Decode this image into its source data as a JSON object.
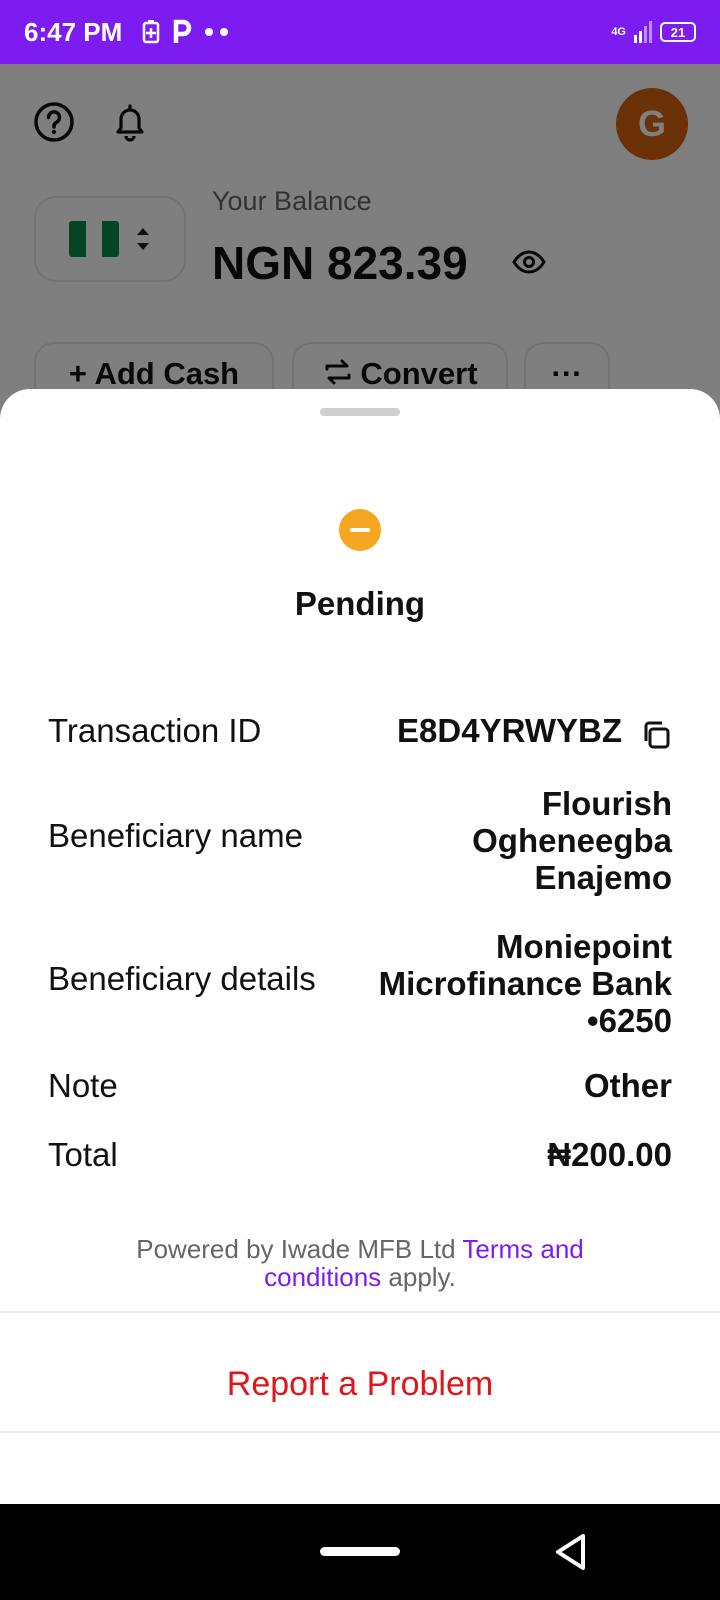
{
  "status_bar": {
    "time": "6:47 PM",
    "network": "4G",
    "battery": "21"
  },
  "background": {
    "avatar_initial": "G",
    "balance_label": "Your Balance",
    "balance_value": "NGN 823.39",
    "actions": {
      "add_cash": "+ Add Cash",
      "convert": "Convert",
      "more": "···"
    }
  },
  "sheet": {
    "status": "Pending",
    "status_color": "#f5a623",
    "rows": {
      "transaction_id": {
        "label": "Transaction ID",
        "value": "E8D4YRWYBZ"
      },
      "beneficiary_name": {
        "label": "Beneficiary name",
        "line1": "Flourish",
        "line2": "Ogheneegba",
        "line3": "Enajemo"
      },
      "beneficiary_details": {
        "label": "Beneficiary details",
        "line1": "Moniepoint",
        "line2": "Microfinance Bank",
        "line3": "•6250"
      },
      "note": {
        "label": "Note",
        "value": "Other"
      },
      "total": {
        "label": "Total",
        "value": "₦200.00"
      }
    },
    "footnote": {
      "prefix": "Powered by Iwade MFB Ltd ",
      "link_line1": "Terms and",
      "link_line2": "conditions",
      "suffix": " apply."
    },
    "report_label": "Report a Problem"
  },
  "colors": {
    "brand": "#7d1cf0",
    "danger": "#e0161b"
  }
}
